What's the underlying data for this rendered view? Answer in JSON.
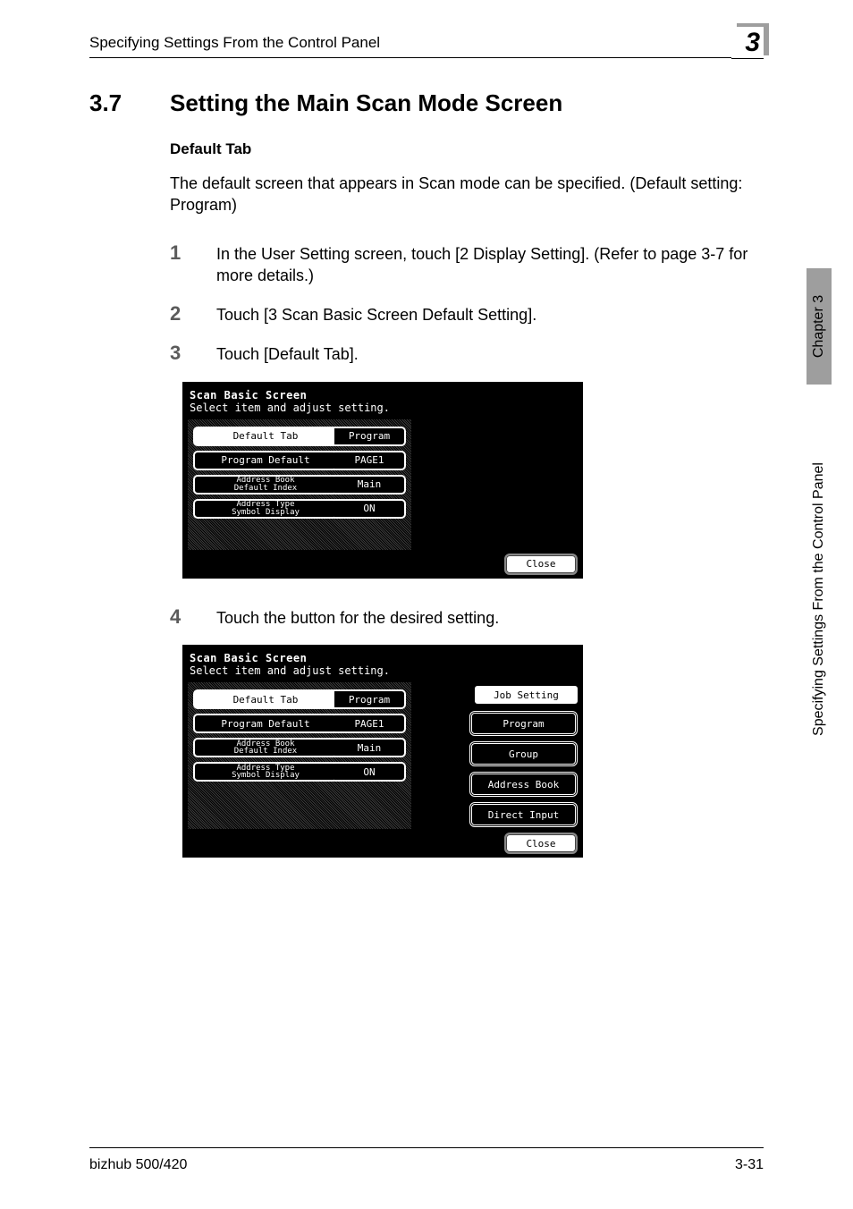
{
  "header": {
    "running_title": "Specifying Settings From the Control Panel",
    "chapter_number": "3"
  },
  "section": {
    "number": "3.7",
    "title": "Setting the Main Scan Mode Screen"
  },
  "subsection": {
    "title": "Default Tab",
    "body": "The default screen that appears in Scan mode can be specified. (Default setting: Program)"
  },
  "steps": {
    "s1": "In the User Setting screen, touch [2 Display Setting]. (Refer to page 3-7 for more details.)",
    "s2": "Touch [3 Scan Basic Screen Default Setting].",
    "s3": "Touch [Default Tab].",
    "s4": "Touch the button for the desired setting."
  },
  "screen1": {
    "title": "Scan Basic Screen",
    "sub": "Select item and adjust setting.",
    "rows": {
      "r1": {
        "label": "Default Tab",
        "value": "Program"
      },
      "r2": {
        "label": "Program Default",
        "value": "PAGE1"
      },
      "r3": {
        "label_l1": "Address Book",
        "label_l2": "Default Index",
        "value": "Main"
      },
      "r4": {
        "label_l1": "Address Type",
        "label_l2": "Symbol Display",
        "value": "ON"
      }
    },
    "close": "Close"
  },
  "screen2": {
    "title": "Scan Basic Screen",
    "sub": "Select item and adjust setting.",
    "rows": {
      "r1": {
        "label": "Default Tab",
        "value": "Program"
      },
      "r2": {
        "label": "Program Default",
        "value": "PAGE1"
      },
      "r3": {
        "label_l1": "Address Book",
        "label_l2": "Default Index",
        "value": "Main"
      },
      "r4": {
        "label_l1": "Address Type",
        "label_l2": "Symbol Display",
        "value": "ON"
      }
    },
    "side": {
      "group_label": "Job Setting",
      "b1": "Program",
      "b2": "Group",
      "b3": "Address Book",
      "b4": "Direct Input"
    },
    "close": "Close"
  },
  "side_tab": {
    "chapter": "Chapter 3",
    "section": "Specifying Settings From the Control Panel"
  },
  "footer": {
    "left": "bizhub 500/420",
    "right": "3-31"
  }
}
